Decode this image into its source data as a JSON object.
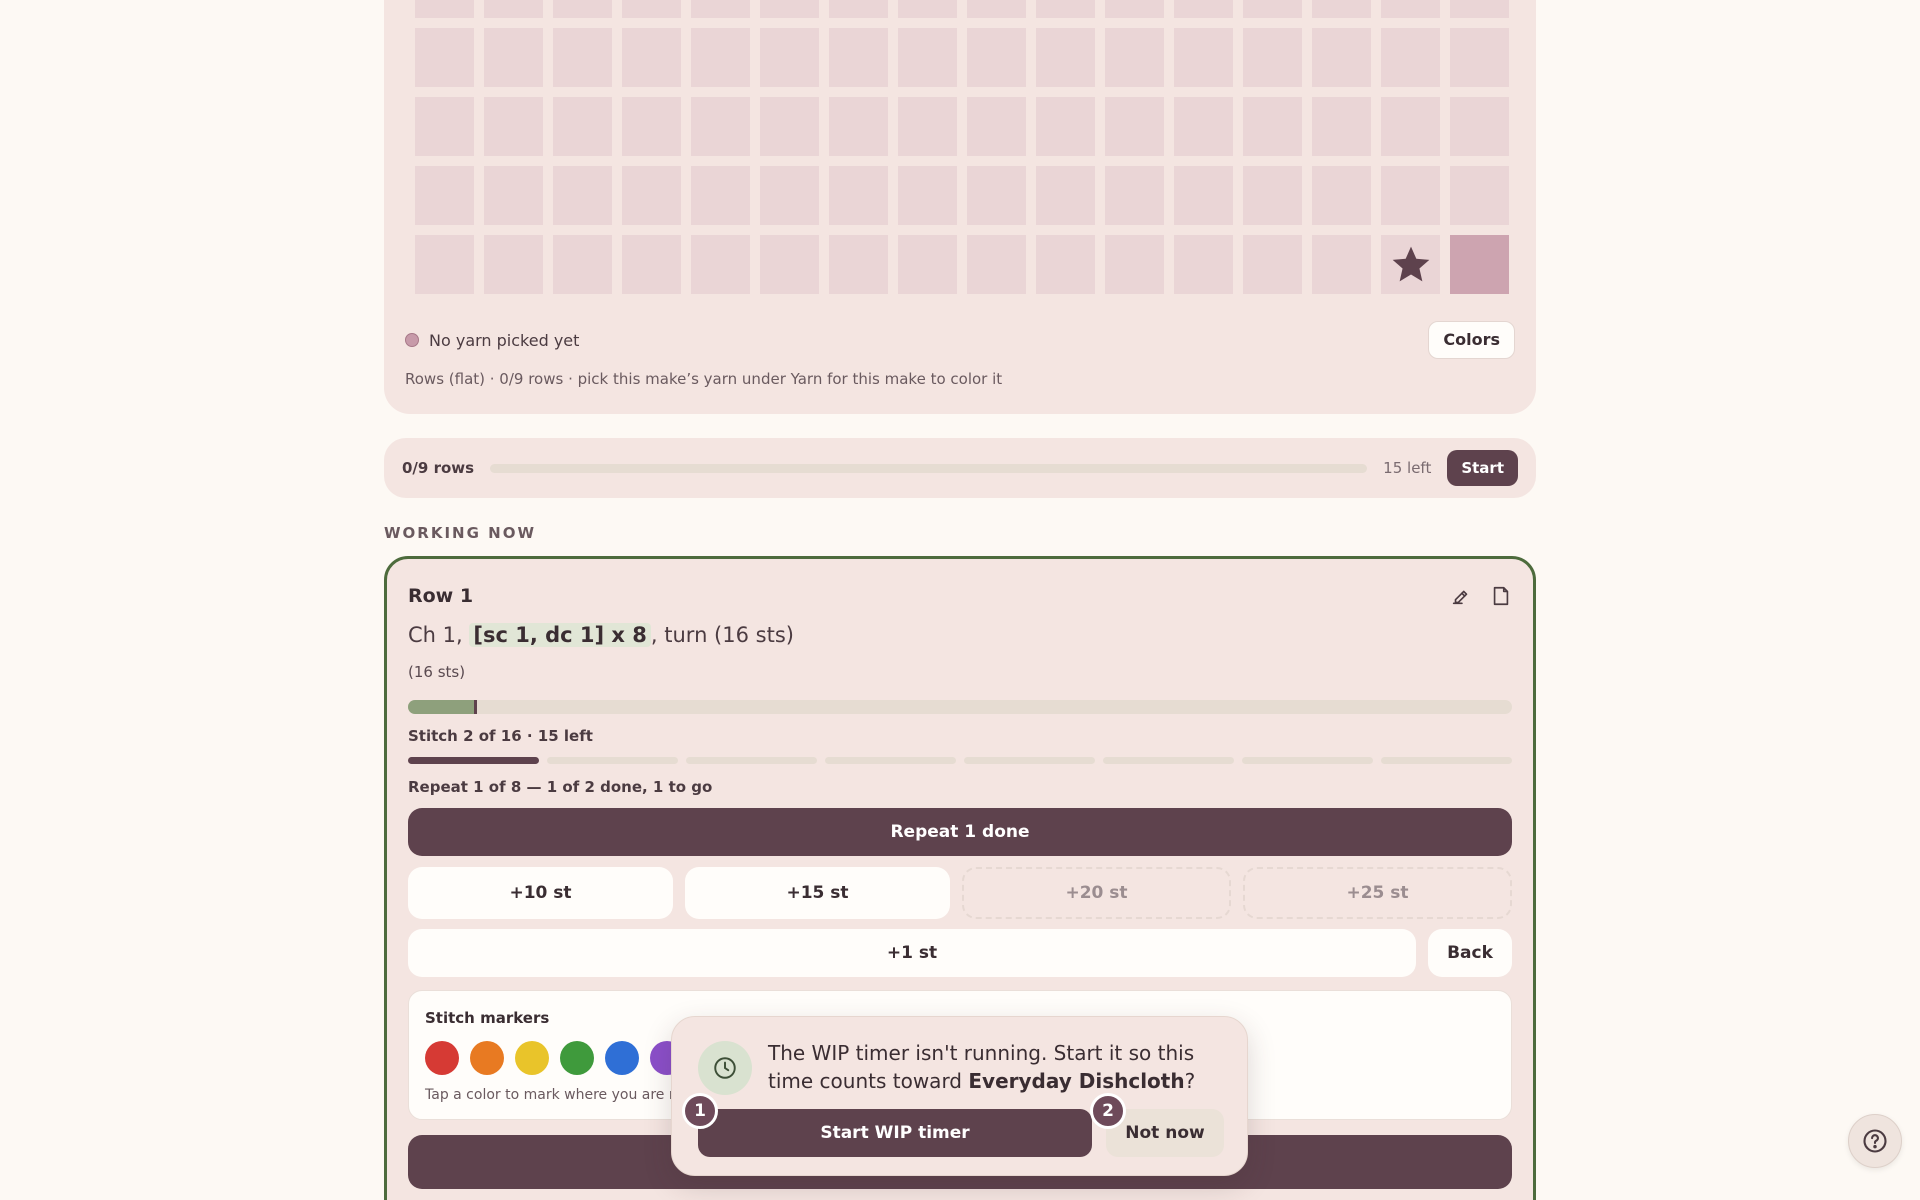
{
  "chart": {
    "rows": 5,
    "cols": 16,
    "current_row_index": 4,
    "done_cells": [
      15
    ],
    "marker_cell": 14,
    "yarn_status": "No yarn picked yet",
    "colors_label": "Colors",
    "note": "Rows (flat) · 0/9 rows · pick this make’s yarn under Yarn for this make to color it"
  },
  "progress": {
    "rows_label": "0/9 rows",
    "rows_done": 0,
    "rows_total": 9,
    "left_label": "15 left",
    "start_label": "Start"
  },
  "section_label": "WORKING NOW",
  "row": {
    "title": "Row 1",
    "instruction_pre": "Ch 1, ",
    "instruction_highlight": "[sc 1, dc 1] x 8",
    "instruction_post": ", turn (16 sts)",
    "stitch_count": "(16 sts)",
    "stitch_progress": 0.0625,
    "stitch_label": "Stitch 2 of 16 · 15 left",
    "repeat_segments": 8,
    "repeat_done": 1,
    "repeat_label": "Repeat 1 of 8 — 1 of 2 done, 1 to go",
    "repeat_button": "Repeat 1 done",
    "increments": [
      {
        "label": "+10 st",
        "enabled": true
      },
      {
        "label": "+15 st",
        "enabled": true
      },
      {
        "label": "+20 st",
        "enabled": false
      },
      {
        "label": "+25 st",
        "enabled": false
      }
    ],
    "plus_one": "+1 st",
    "back": "Back"
  },
  "markers": {
    "title": "Stitch markers",
    "colors": [
      "#d63a34",
      "#e87a22",
      "#e9c42a",
      "#3f9a3c",
      "#2f6fd6",
      "#8b4fc9"
    ],
    "hint": "Tap a color to mark where you are no"
  },
  "popup": {
    "text_pre": "The WIP timer isn't running. Start it so this time counts toward ",
    "project": "Everyday Dishcloth",
    "text_post": "?",
    "start_label": "Start WIP timer",
    "not_now_label": "Not now",
    "badge1": "1",
    "badge2": "2"
  },
  "colors": {
    "accent": "#5e424d",
    "panel": "#f4e5e1",
    "cell": "#ead5d6",
    "cell_done": "#cda4b0",
    "active_border": "#4d6b3c"
  }
}
